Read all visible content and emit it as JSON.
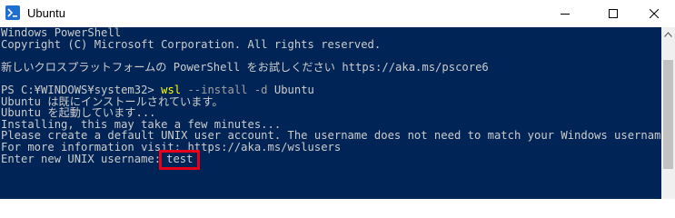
{
  "window": {
    "title": "Ubuntu",
    "icon": "ubuntu-terminal-icon",
    "controls": {
      "minimize": "minimize-icon",
      "maximize": "maximize-icon",
      "close": "close-icon"
    }
  },
  "terminal": {
    "background": "#012456",
    "text_color": "#cccccc",
    "lines": {
      "l0": "Windows PowerShell",
      "l1": "Copyright (C) Microsoft Corporation. All rights reserved.",
      "l2": "",
      "l3": "新しいクロスプラットフォームの PowerShell をお試しください https://aka.ms/pscore6",
      "l4": "",
      "l5_prompt": "PS C:¥WINDOWS¥system32> ",
      "l5_cmd": "wsl",
      "l5_args": " --install -d ",
      "l5_value": "Ubuntu",
      "l6": "Ubuntu は既にインストールされています。",
      "l7": "Ubuntu を起動しています...",
      "l8": "Installing, this may take a few minutes...",
      "l9": "Please create a default UNIX user account. The username does not need to match your Windows username.",
      "l10": "For more information visit: https://aka.ms/wslusers",
      "l11_prompt": "Enter new UNIX username:",
      "l11_input": "test"
    },
    "highlight_color": "#e6001a"
  }
}
